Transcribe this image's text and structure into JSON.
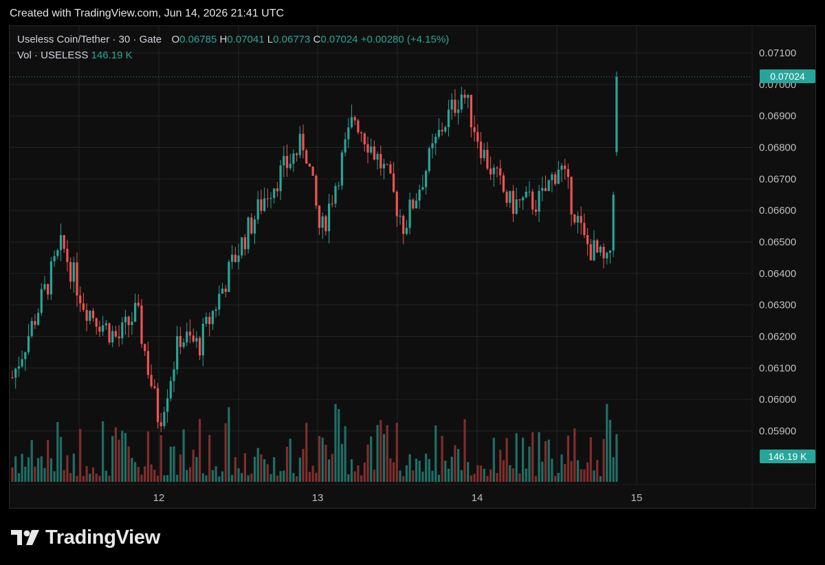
{
  "caption": "Created with TradingView.com, Jun 14, 2026 21:41 UTC",
  "legend": {
    "symbol": "Useless Coin/Tether · 30 · Gate",
    "o_label": "O",
    "o": "0.06785",
    "h_label": "H",
    "h": "0.07041",
    "l_label": "L",
    "l": "0.06773",
    "c_label": "C",
    "c": "0.07024",
    "change": "+0.00280 (+4.15%)",
    "vol_label": "Vol · USELESS",
    "vol": "146.19 K"
  },
  "last_price_tag": "0.07024",
  "volume_tag": "146.19 K",
  "brand": {
    "name": "TradingView",
    "icon": "tradingview-logo-icon"
  },
  "colors": {
    "up": "#26a69a",
    "down": "#ef5350",
    "up_vol": "#1f6f66",
    "down_vol": "#7f2f2c",
    "background": "#0f0f0f",
    "grid": "#232323"
  },
  "chart_data": {
    "type": "candlestick",
    "title": "Useless Coin/Tether · 30 · Gate",
    "y_axis": {
      "range": [
        0.0585,
        0.0714
      ],
      "ticks": [
        "0.07100",
        "0.07000",
        "0.06900",
        "0.06800",
        "0.06700",
        "0.06600",
        "0.06500",
        "0.06400",
        "0.06300",
        "0.06200",
        "0.06100",
        "0.06000",
        "0.05900"
      ]
    },
    "x_axis": {
      "ticks": [
        "12",
        "13",
        "14",
        "15"
      ]
    },
    "grid": true,
    "key_levels": [
      {
        "time": "11 (start)",
        "price": 0.0607
      },
      {
        "time": "11 peak",
        "price": 0.0649
      },
      {
        "time": "12 low",
        "price": 0.0593
      },
      {
        "time": "13 peak",
        "price": 0.0692
      },
      {
        "time": "13/14 low",
        "price": 0.0652
      },
      {
        "time": "14 peak",
        "price": 0.0702
      },
      {
        "time": "14 low",
        "price": 0.0637
      },
      {
        "time": "last",
        "price": 0.07024
      }
    ],
    "last_bar": {
      "open": 0.06785,
      "high": 0.07041,
      "low": 0.06773,
      "close": 0.07024,
      "volume_k": 146.19
    }
  }
}
